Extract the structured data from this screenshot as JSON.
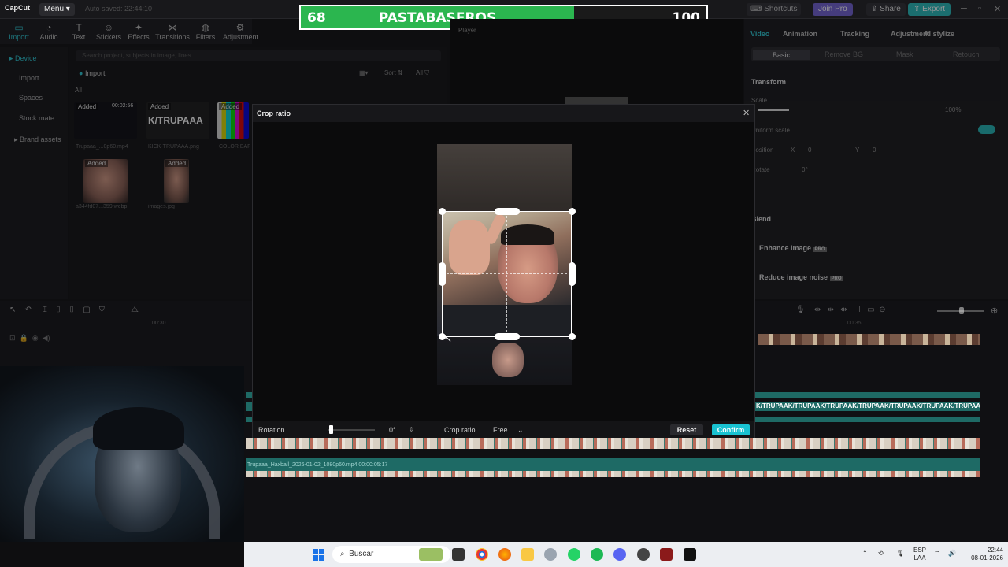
{
  "app": {
    "logo": "CapCut",
    "menu_label": "Menu",
    "autosave": "Auto saved: 22:44:10"
  },
  "scoreboard": {
    "left_score": "68",
    "team_name": "PASTABASEROS",
    "right_score": "100"
  },
  "topbar": {
    "shortcuts": "Shortcuts",
    "join_pro": "Join Pro",
    "share": "Share",
    "export": "Export"
  },
  "toolbar": {
    "items": [
      "Import",
      "Audio",
      "Text",
      "Stickers",
      "Effects",
      "Transitions",
      "Filters",
      "Adjustment"
    ]
  },
  "leftnav": {
    "items": [
      "Device",
      "Import",
      "Spaces",
      "Stock mate...",
      "Brand assets"
    ]
  },
  "media": {
    "search_placeholder": "Search project, subjects in image, lines",
    "import_label": "Import",
    "all_label": "All",
    "sort_label": "Sort",
    "filter_label": "All",
    "added_label": "Added",
    "duration": "00:02:56",
    "kick_text": "K/TRUPAAA",
    "files": [
      "Trupaaa_...0p60.mp4",
      "KICK-TRUPAAA.png",
      "COLOR BARS",
      "a344fd07...359.webp",
      "images.jpg"
    ]
  },
  "inspector": {
    "tabs": [
      "Video",
      "Animation",
      "Tracking",
      "Adjustment",
      "AI stylize"
    ],
    "subtabs": [
      "Basic",
      "Remove BG",
      "Mask",
      "Retouch"
    ],
    "transform": "Transform",
    "scale": "Scale",
    "scale_value": "100%",
    "uniform_scale": "Uniform scale",
    "position": "Position",
    "pos_x_label": "X",
    "pos_x": "0",
    "pos_y_label": "Y",
    "pos_y": "0",
    "rotate": "Rotate",
    "rotate_value": "0°",
    "blend": "Blend",
    "enhance": "Enhance image",
    "reduce_noise": "Reduce image noise",
    "pro_badge": "PRO"
  },
  "player_label": "Player",
  "timeline": {
    "ruler_a": "00:30",
    "ruler_b": "00:35",
    "text_track": "K/TRUPAAK/TRUPAAK/TRUPAAK/TRUPAAK/TRUPAAK/TRUPAAK/TRUPAAK/TRUPAAK/TRUPAAK/TRUPAA",
    "clip_label": "Trupaaa_Haxball_2026-01-02_1080p60.mp4   00:00:05:17"
  },
  "modal": {
    "title": "Crop ratio",
    "rotation_label": "Rotation",
    "rotation_value": "0°",
    "crop_ratio_label": "Crop ratio",
    "crop_ratio_value": "Free",
    "reset": "Reset",
    "confirm": "Confirm",
    "rotation_fraction": 0.0
  },
  "taskbar": {
    "search": "Buscar",
    "lang": "ESP",
    "lang2": "LAA",
    "time": "22:44",
    "date": "08-01-2026"
  },
  "colors": {
    "accent": "#18c2d1",
    "score_green": "#2bb64f",
    "join_pro": "#6a5acd"
  }
}
